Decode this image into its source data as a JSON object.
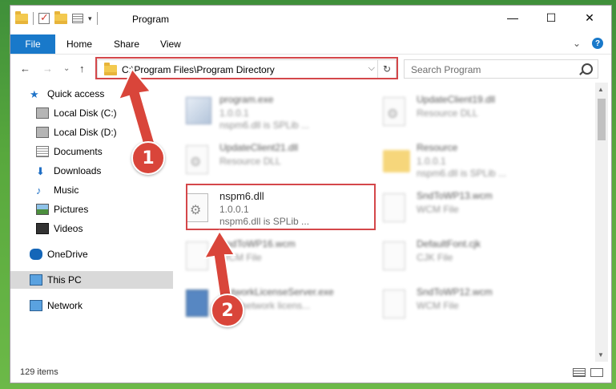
{
  "window": {
    "title": "Program",
    "controls": {
      "minimize": "—",
      "maximize": "☐",
      "close": "✕"
    }
  },
  "ribbon": {
    "file": "File",
    "tabs": [
      "Home",
      "Share",
      "View"
    ],
    "help": "?",
    "expand": "⌄"
  },
  "address": {
    "path": "C:\\Program Files\\Program Directory",
    "dropdown": "⌵",
    "refresh": "↻"
  },
  "nav": {
    "back": "←",
    "forward": "→",
    "recent": "⌄",
    "up": "↑"
  },
  "search": {
    "placeholder": "Search Program"
  },
  "sidebar": {
    "items": [
      {
        "label": "Quick access",
        "icon": "star-icon",
        "pinned": false
      },
      {
        "label": "Local Disk (C:)",
        "icon": "disk-icon",
        "pinned": true
      },
      {
        "label": "Local Disk (D:)",
        "icon": "disk-icon",
        "pinned": true
      },
      {
        "label": "Documents",
        "icon": "documents-icon",
        "pinned": true
      },
      {
        "label": "Downloads",
        "icon": "downloads-icon",
        "pinned": true
      },
      {
        "label": "Music",
        "icon": "music-icon",
        "pinned": true
      },
      {
        "label": "Pictures",
        "icon": "pictures-icon",
        "pinned": true
      },
      {
        "label": "Videos",
        "icon": "videos-icon",
        "pinned": true
      },
      {
        "label": "OneDrive",
        "icon": "onedrive-icon",
        "pinned": false
      },
      {
        "label": "This PC",
        "icon": "this-pc-icon",
        "pinned": false
      },
      {
        "label": "Network",
        "icon": "network-icon",
        "pinned": false
      }
    ],
    "pin_glyph": "📌"
  },
  "files": [
    {
      "name": "program.exe",
      "line2": "1.0.0.1",
      "line3": "nspm6.dll is SPLib ...",
      "icon": "exe"
    },
    {
      "name": "UpdateClient19.dll",
      "line2": "Resource DLL",
      "line3": "",
      "icon": "dll"
    },
    {
      "name": "UpdateClient21.dll",
      "line2": "Resource DLL",
      "line3": "",
      "icon": "dll"
    },
    {
      "name": "Resource",
      "line2": "1.0.0.1",
      "line3": "nspm6.dll is SPLib ...",
      "icon": "folder"
    },
    {
      "name": "nspm6.dll",
      "line2": "1.0.0.1",
      "line3": "nspm6.dll is SPLib ...",
      "icon": "dll"
    },
    {
      "name": "SndToWP13.wcm",
      "line2": "WCM File",
      "line3": "",
      "icon": "file"
    },
    {
      "name": "SndToWP16.wcm",
      "line2": "WCM File",
      "line3": "",
      "icon": "file"
    },
    {
      "name": "DefaultFont.cjk",
      "line2": "CJK File",
      "line3": "",
      "icon": "file"
    },
    {
      "name": "NetworkLicenseServer.exe",
      "line2": "BBY network licens...",
      "line3": "",
      "icon": "net"
    },
    {
      "name": "SndToWP12.wcm",
      "line2": "WCM File",
      "line3": "",
      "icon": "file"
    }
  ],
  "status": {
    "count": "129 items"
  },
  "steps": {
    "one": "1",
    "two": "2"
  },
  "colors": {
    "accent": "#1979ca",
    "highlight": "#d4474a",
    "badge": "#d9453a"
  }
}
